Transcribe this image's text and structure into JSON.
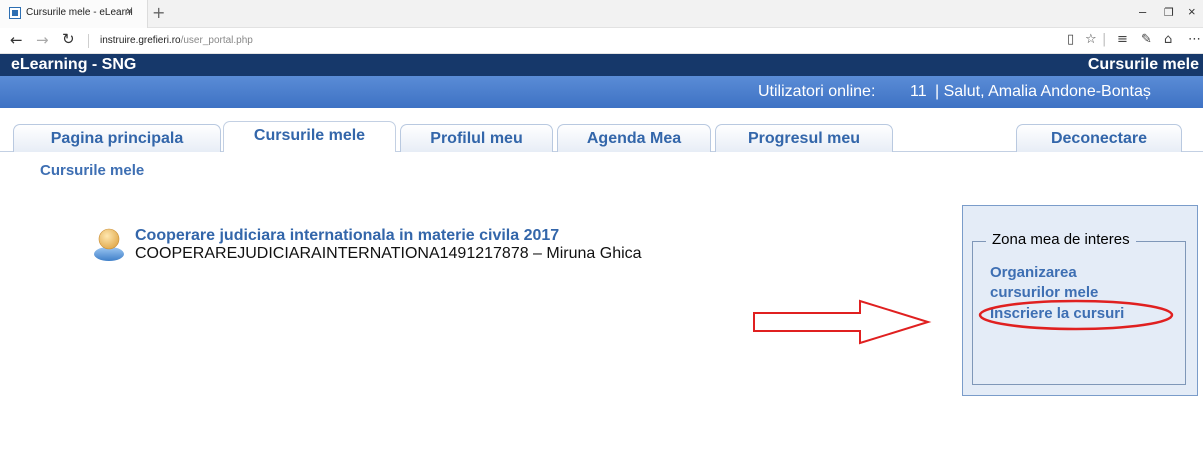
{
  "browser": {
    "tab_title": "Cursurile mele - eLearni",
    "tab_close": "×",
    "new_tab": "+",
    "url_domain": "instruire.grefieri.ro",
    "url_path": "/user_portal.php"
  },
  "site": {
    "name": "eLearning - SNG",
    "page_label": "Cursurile mele",
    "online_label": "Utilizatori online:",
    "online_count": "11",
    "greeting": "| Salut, Amalia Andone-Bontaș"
  },
  "tabs": [
    {
      "label": "Pagina principala",
      "active": false
    },
    {
      "label": "Cursurile mele",
      "active": true
    },
    {
      "label": "Profilul meu",
      "active": false
    },
    {
      "label": "Agenda Mea",
      "active": false
    },
    {
      "label": "Progresul meu",
      "active": false
    }
  ],
  "logout_label": "Deconectare",
  "section_title": "Cursurile mele",
  "course": {
    "title": "Cooperare judiciara internationala in materie civila 2017",
    "code_line": "COOPERAREJUDICIARAINTERNATIONA1491217878 – Miruna Ghica"
  },
  "side_panel": {
    "legend": "Zona mea de interes",
    "links": [
      "Organizarea",
      "cursurilor mele",
      "Inscriere la cursuri"
    ]
  },
  "colors": {
    "header_dark": "#16386a",
    "info_bar": "#4a7fcf",
    "link_blue": "#3366aa",
    "annotation_red": "#e02020"
  }
}
